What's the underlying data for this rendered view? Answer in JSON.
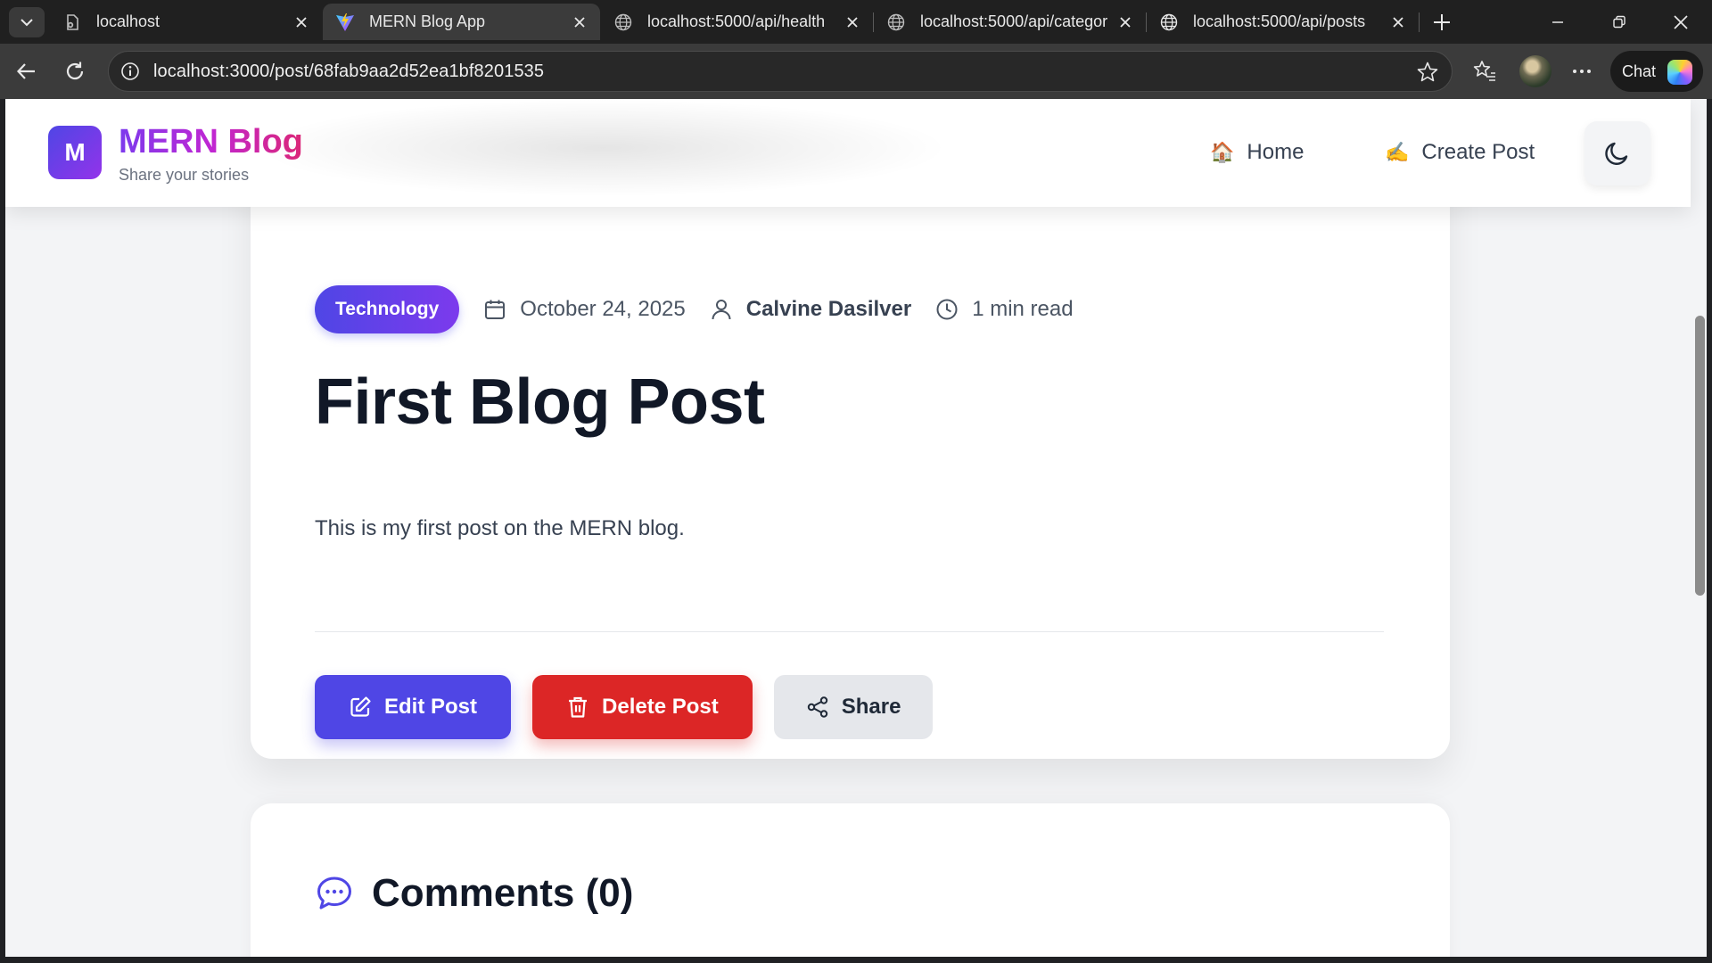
{
  "browser": {
    "tabs": [
      {
        "title": "localhost",
        "favicon": "broken-page-icon",
        "active": false
      },
      {
        "title": "MERN Blog App",
        "favicon": "vite-logo-icon",
        "active": true
      },
      {
        "title": "localhost:5000/api/health",
        "favicon": "globe-icon",
        "active": false
      },
      {
        "title": "localhost:5000/api/categor",
        "favicon": "globe-icon",
        "active": false
      },
      {
        "title": "localhost:5000/api/posts",
        "favicon": "globe-icon",
        "active": false
      }
    ],
    "url": "localhost:3000/post/68fab9aa2d52ea1bf8201535",
    "chat_label": "Chat"
  },
  "app": {
    "logo_letter": "M",
    "brand": "MERN Blog",
    "tagline": "Share your stories",
    "nav": {
      "home": {
        "emoji": "🏠",
        "label": "Home"
      },
      "create": {
        "emoji": "✍️",
        "label": "Create Post"
      }
    }
  },
  "post": {
    "category": "Technology",
    "date": "October 24, 2025",
    "author": "Calvine Dasilver",
    "read_time": "1 min read",
    "title": "First Blog Post",
    "body": "This is my first post on the MERN blog.",
    "actions": {
      "edit": "Edit Post",
      "delete": "Delete Post",
      "share": "Share"
    }
  },
  "comments": {
    "heading": "Comments (0)"
  },
  "colors": {
    "primary": "#4f46e5",
    "danger": "#dc2626",
    "neutral_button": "#e5e7eb",
    "page_bg": "#f3f4f6"
  }
}
